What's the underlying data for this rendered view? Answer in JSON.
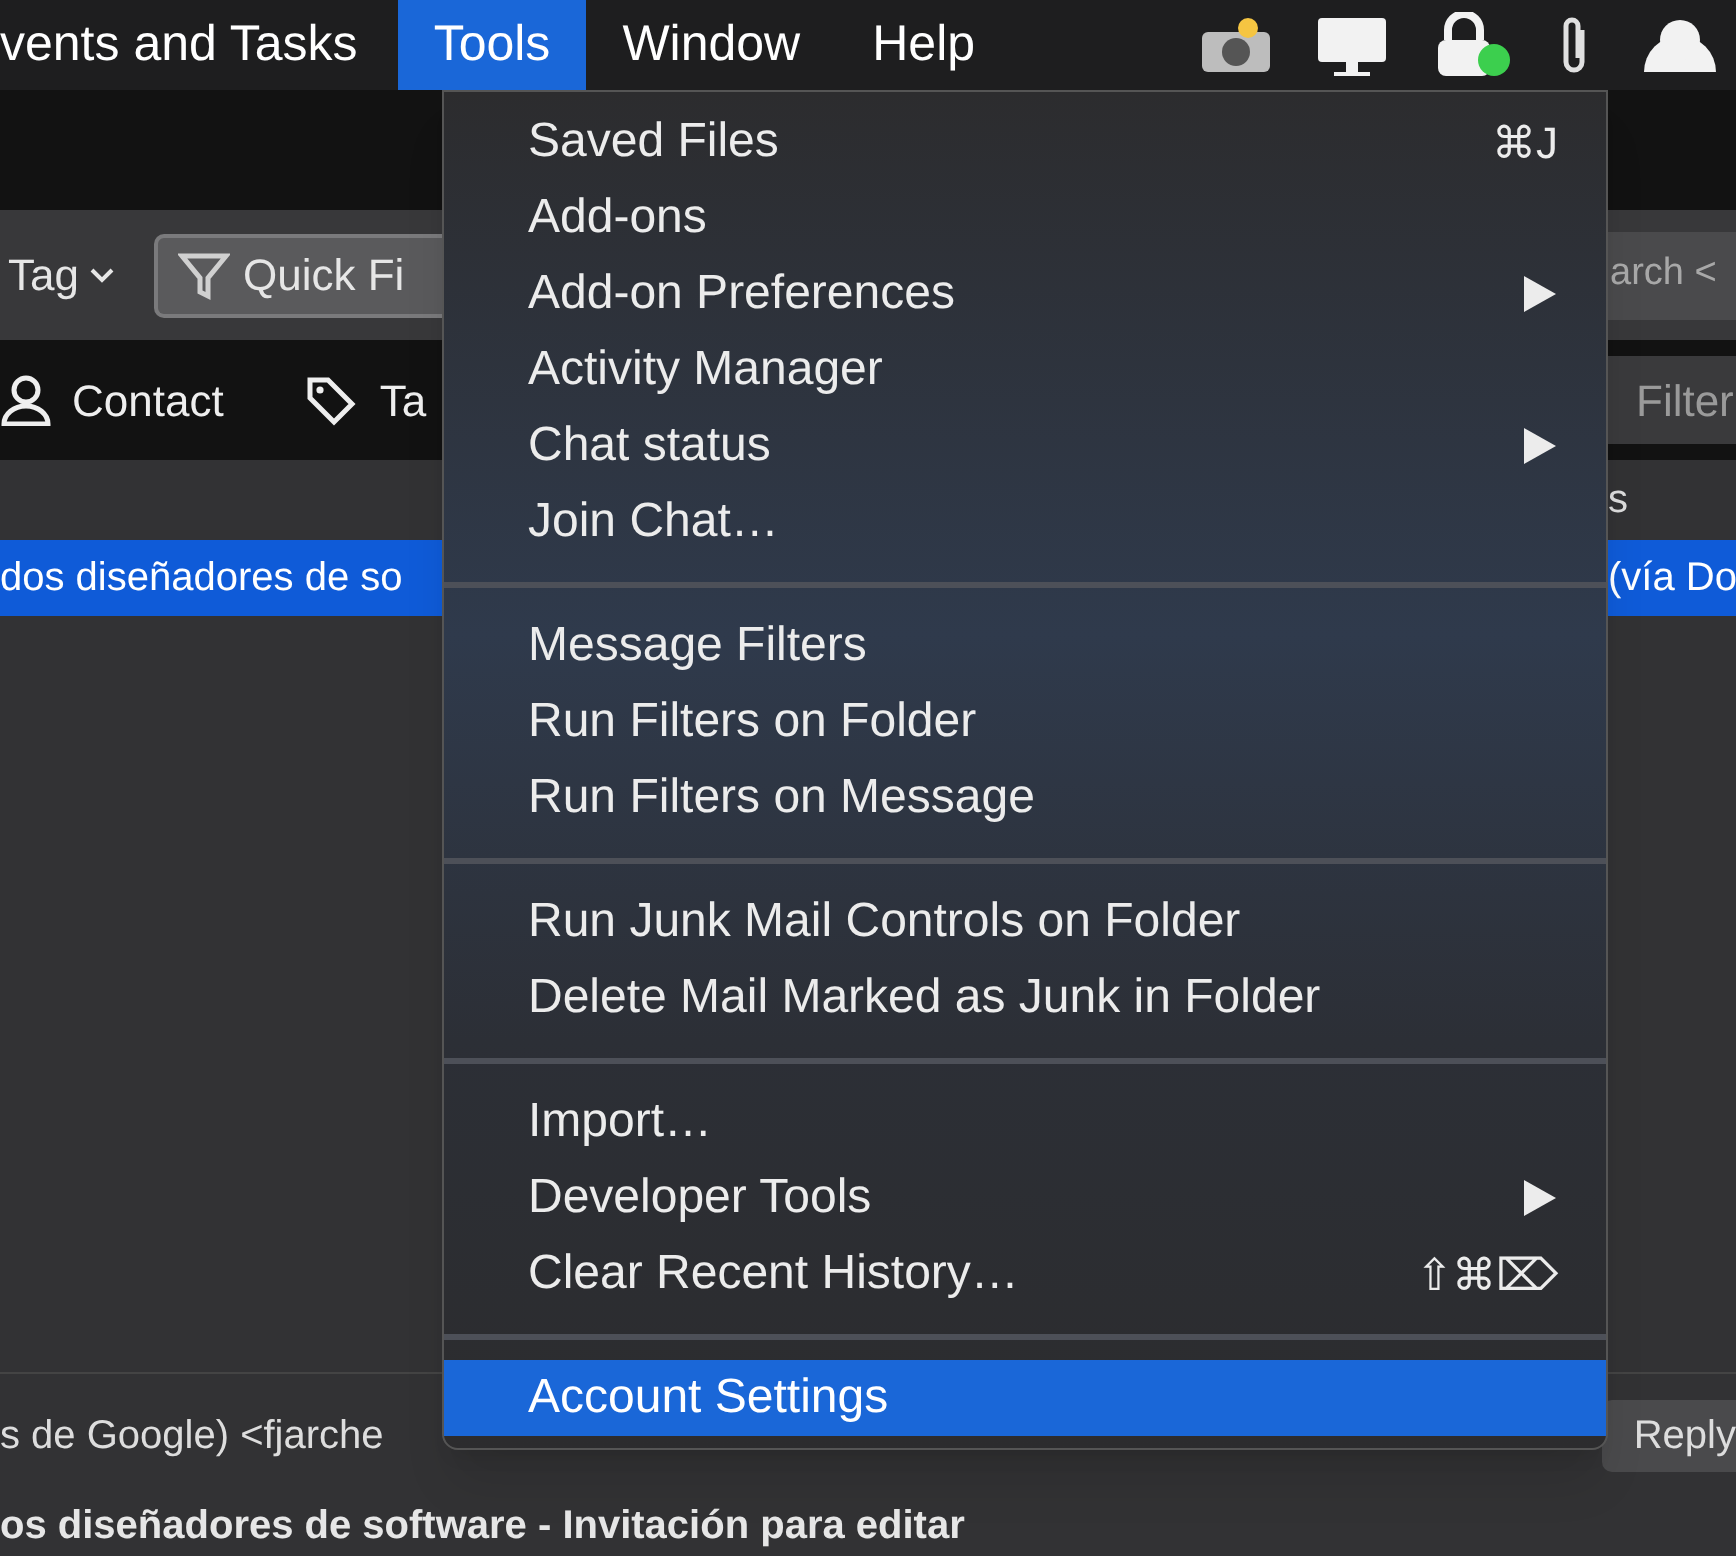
{
  "menubar": {
    "items": [
      {
        "label": "vents and Tasks",
        "selected": false
      },
      {
        "label": "Tools",
        "selected": true
      },
      {
        "label": "Window",
        "selected": false
      },
      {
        "label": "Help",
        "selected": false
      }
    ]
  },
  "toolbar": {
    "tag_button": "Tag",
    "quick_filter": "Quick Fi",
    "search": "arch <"
  },
  "filter_bar": {
    "contact": "Contact",
    "tag": "Ta",
    "filter": "Filter"
  },
  "message_list": {
    "column_header": "s",
    "selected_row": {
      "subject": "dos diseñadores de so",
      "sender": "(vía Do"
    }
  },
  "preview": {
    "sender": "s de Google) <fjarche",
    "reply": "Reply",
    "subject": "os diseñadores de software - Invitación para editar"
  },
  "menu": {
    "items": [
      {
        "kind": "item",
        "label": "Saved Files",
        "shortcut": "⌘J",
        "submenu": false,
        "selected": false
      },
      {
        "kind": "item",
        "label": "Add-ons",
        "submenu": false,
        "selected": false
      },
      {
        "kind": "item",
        "label": "Add-on Preferences",
        "submenu": true,
        "selected": false
      },
      {
        "kind": "item",
        "label": "Activity Manager",
        "submenu": false,
        "selected": false
      },
      {
        "kind": "item",
        "label": "Chat status",
        "submenu": true,
        "selected": false
      },
      {
        "kind": "item",
        "label": "Join Chat…",
        "submenu": false,
        "selected": false
      },
      {
        "kind": "separator"
      },
      {
        "kind": "item",
        "label": "Message Filters",
        "submenu": false,
        "selected": false
      },
      {
        "kind": "item",
        "label": "Run Filters on Folder",
        "submenu": false,
        "selected": false
      },
      {
        "kind": "item",
        "label": "Run Filters on Message",
        "submenu": false,
        "selected": false
      },
      {
        "kind": "separator"
      },
      {
        "kind": "item",
        "label": "Run Junk Mail Controls on Folder",
        "submenu": false,
        "selected": false
      },
      {
        "kind": "item",
        "label": "Delete Mail Marked as Junk in Folder",
        "submenu": false,
        "selected": false
      },
      {
        "kind": "separator"
      },
      {
        "kind": "item",
        "label": "Import…",
        "submenu": false,
        "selected": false
      },
      {
        "kind": "item",
        "label": "Developer Tools",
        "submenu": true,
        "selected": false
      },
      {
        "kind": "item",
        "label": "Clear Recent History…",
        "shortcut": "⇧⌘⌦",
        "submenu": false,
        "selected": false
      },
      {
        "kind": "separator"
      },
      {
        "kind": "item",
        "label": "Account Settings",
        "submenu": false,
        "selected": true
      }
    ]
  }
}
